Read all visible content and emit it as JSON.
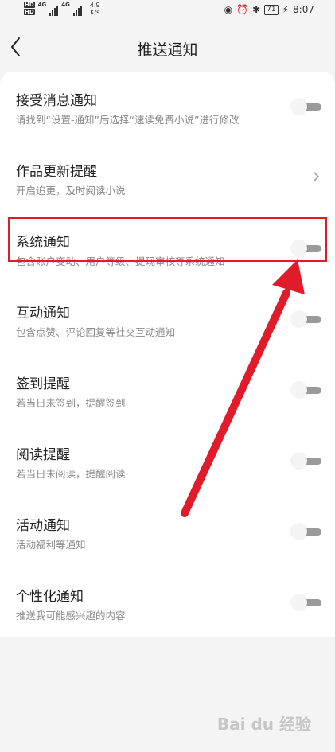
{
  "status_bar": {
    "hd_labels": [
      "HD",
      "HD"
    ],
    "network": [
      "4G",
      "4G"
    ],
    "speed_value": "4.9",
    "speed_unit": "K/s",
    "battery": "71",
    "time": "8:07"
  },
  "header": {
    "title": "推送通知",
    "back_icon": "chevron-left-icon"
  },
  "settings": [
    {
      "title": "接受消息通知",
      "subtitle": "请找到“设置-通知”后选择“速读免费小说”进行修改",
      "control": "toggle",
      "on": false
    },
    {
      "title": "作品更新提醒",
      "subtitle": "开启追更，及时阅读小说",
      "control": "chevron"
    },
    {
      "title": "系统通知",
      "subtitle": "包含账户变动、用户等级、提现审核等系统通知",
      "control": "toggle",
      "on": false
    },
    {
      "title": "互动通知",
      "subtitle": "包含点赞、评论回复等社交互动通知",
      "control": "toggle",
      "on": false
    },
    {
      "title": "签到提醒",
      "subtitle": "若当日未签到，提醒签到",
      "control": "toggle",
      "on": false
    },
    {
      "title": "阅读提醒",
      "subtitle": "若当日未阅读，提醒阅读",
      "control": "toggle",
      "on": false
    },
    {
      "title": "活动通知",
      "subtitle": "活动福利等通知",
      "control": "toggle",
      "on": false
    },
    {
      "title": "个性化通知",
      "subtitle": "推送我可能感兴趣的内容",
      "control": "toggle",
      "on": false
    }
  ],
  "annotation": {
    "color": "#e01b2a"
  },
  "watermark": "Bai du 经验",
  "colors": {
    "background": "#f4f4f4",
    "card": "#ffffff",
    "toggle_off_track": "#9a9a9a"
  }
}
